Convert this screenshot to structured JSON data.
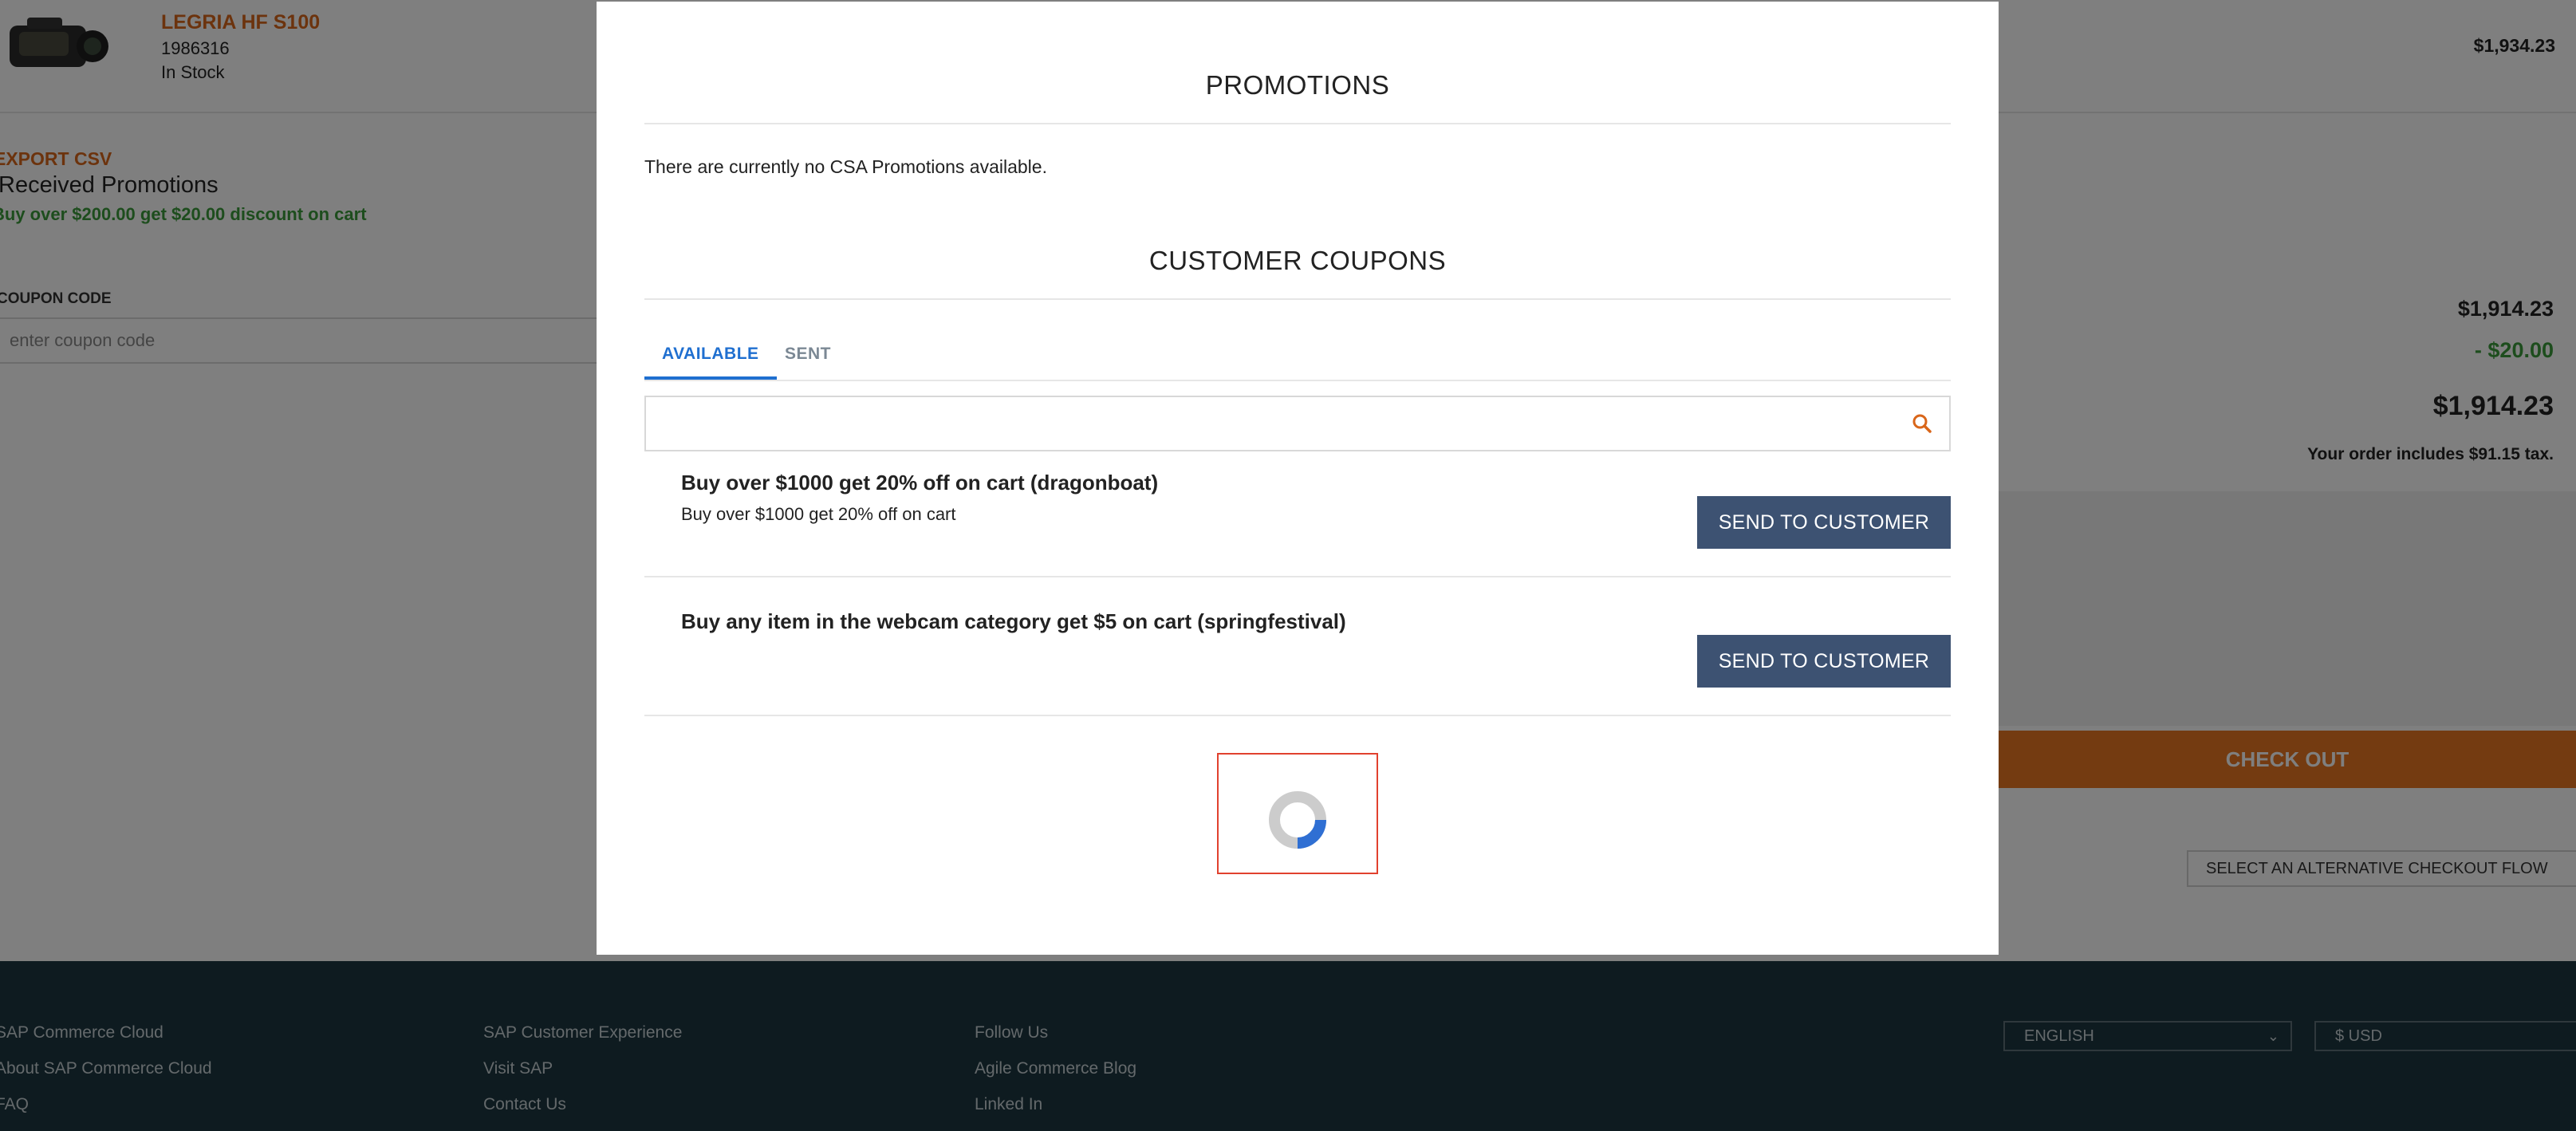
{
  "product": {
    "name": "LEGRIA HF S100",
    "code": "1986316",
    "stock": "In Stock",
    "price": "$1,934.23"
  },
  "promotions_panel": {
    "export_csv": "EXPORT CSV",
    "received_title": "Received Promotions",
    "received_item": "Buy over $200.00 get $20.00 discount on cart",
    "coupon_label": "COUPON CODE",
    "coupon_placeholder": "enter coupon code"
  },
  "summary": {
    "subtotal": "$1,914.23",
    "discount": "- $20.00",
    "total": "$1,914.23",
    "tax_note": "Your order includes $91.15 tax.",
    "checkout_label": "CHECK OUT",
    "alt_flow_label": "SELECT AN ALTERNATIVE CHECKOUT FLOW"
  },
  "footer": {
    "col1": [
      "SAP Commerce Cloud",
      "About SAP Commerce Cloud",
      "FAQ"
    ],
    "col2": [
      "SAP Customer Experience",
      "Visit SAP",
      "Contact Us"
    ],
    "col3": [
      "Follow Us",
      "Agile Commerce Blog",
      "Linked In"
    ],
    "language": "ENGLISH",
    "currency": "$ USD"
  },
  "modal": {
    "promotions_title": "PROMOTIONS",
    "no_promotions": "There are currently no CSA Promotions available.",
    "coupons_title": "CUSTOMER COUPONS",
    "tabs": [
      {
        "label": "AVAILABLE",
        "active": true
      },
      {
        "label": "SENT",
        "active": false
      }
    ],
    "search_icon": "search-icon",
    "coupons": [
      {
        "name": "Buy over $1000 get 20% off on cart (dragonboat)",
        "description": "Buy over $1000 get 20% off on cart",
        "button": "SEND TO CUSTOMER"
      },
      {
        "name": "Buy any item in the webcam category get $5 on cart (springfestival)",
        "description": "",
        "button": "SEND TO CUSTOMER"
      }
    ],
    "loading_icon": "loading-spinner-icon"
  },
  "colors": {
    "accent_orange": "#e87722",
    "link_blue": "#1f6fd0",
    "button_navy": "#3d5272",
    "discount_green": "#3a9a3a",
    "highlight_red": "#e1412e",
    "footer_bg": "#1c3640"
  }
}
